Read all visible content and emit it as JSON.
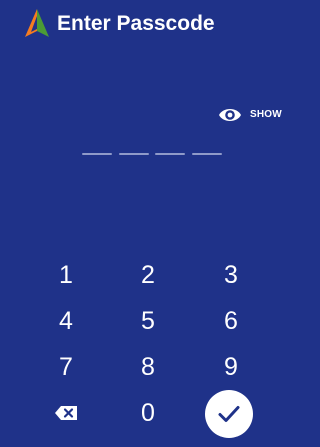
{
  "app_bar": {
    "title": "Enter Passcode",
    "logo_icon": "app-logo-icon"
  },
  "toggle": {
    "label": "SHOW",
    "icon": "eye-icon"
  },
  "keypad": {
    "digits": [
      "1",
      "2",
      "3",
      "4",
      "5",
      "6",
      "7",
      "8",
      "9",
      "0"
    ],
    "backspace_icon": "backspace-icon",
    "confirm_icon": "check-icon"
  },
  "colors": {
    "background": "#1f3289",
    "text": "#ffffff",
    "pin_slot": "#8f9ac9",
    "confirm_background": "#ffffff",
    "check": "#1f3289",
    "logo_orange": "#f47c20",
    "logo_green": "#4b9b35",
    "logo_blue": "#1f3289"
  }
}
